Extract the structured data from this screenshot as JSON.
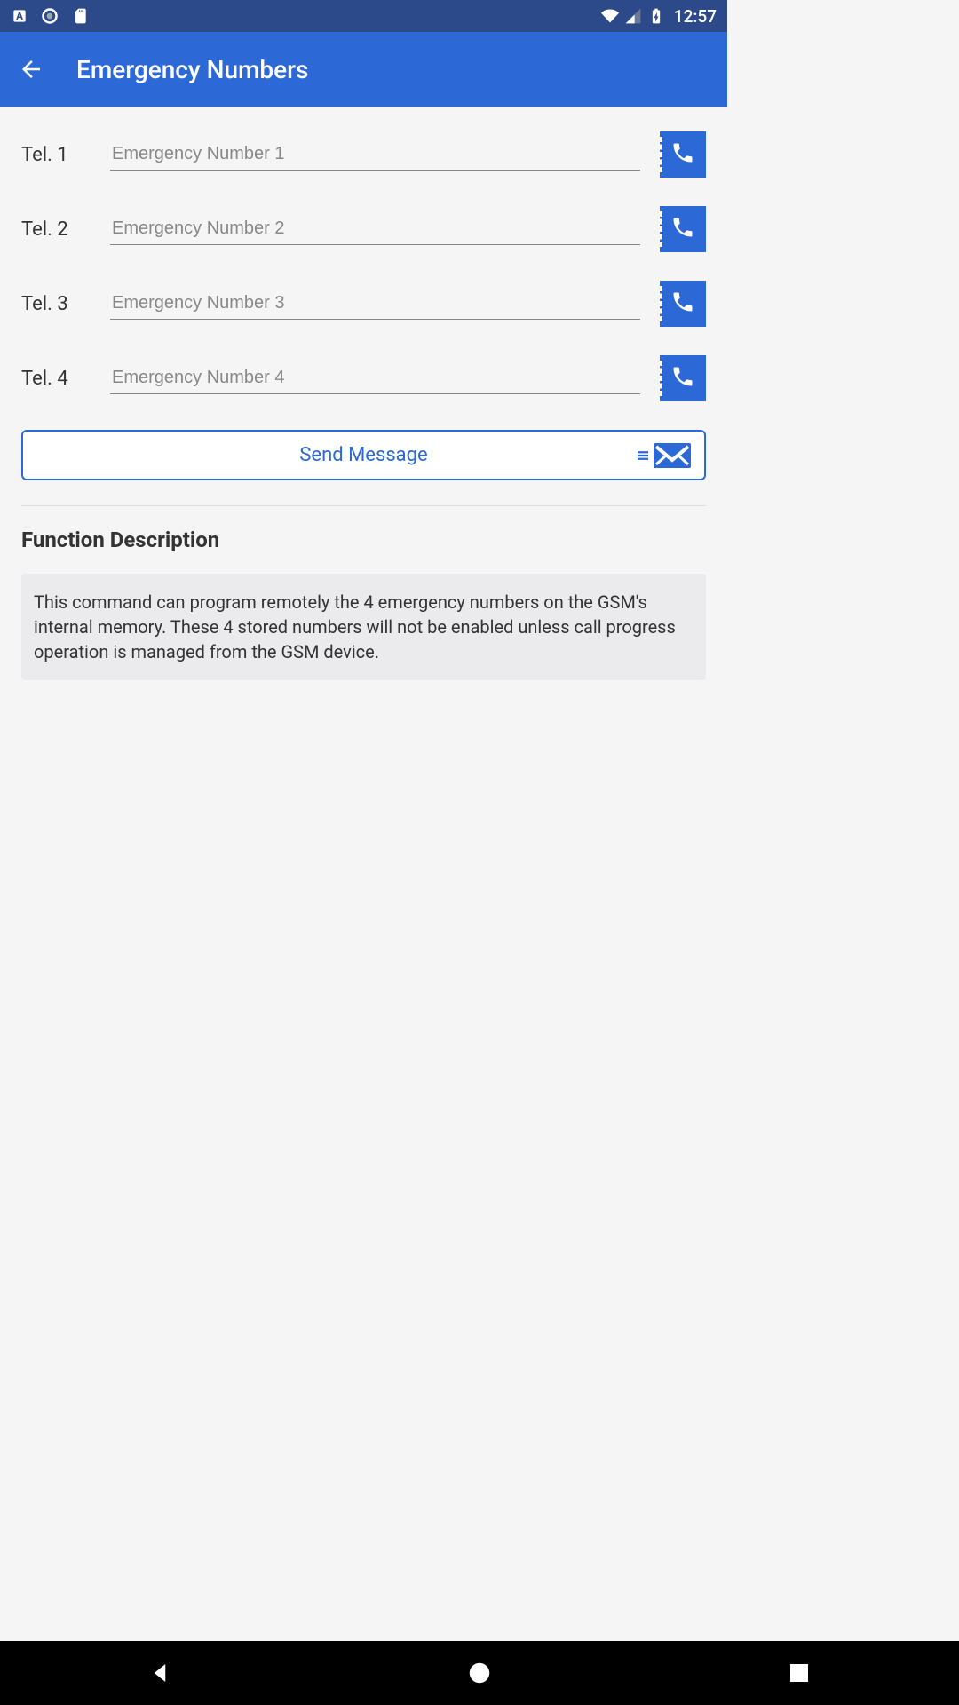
{
  "status_bar": {
    "time": "12:57"
  },
  "app_bar": {
    "title": "Emergency Numbers"
  },
  "tel_rows": [
    {
      "label": "Tel. 1",
      "placeholder": "Emergency Number 1",
      "value": ""
    },
    {
      "label": "Tel. 2",
      "placeholder": "Emergency Number 2",
      "value": ""
    },
    {
      "label": "Tel. 3",
      "placeholder": "Emergency Number 3",
      "value": ""
    },
    {
      "label": "Tel. 4",
      "placeholder": "Emergency Number 4",
      "value": ""
    }
  ],
  "send_button": {
    "label": "Send Message"
  },
  "description": {
    "title": "Function Description",
    "body": "This command can program remotely the 4 emergency numbers on the GSM's internal memory. These 4 stored numbers will not be enabled unless call progress operation is managed from the GSM device."
  }
}
